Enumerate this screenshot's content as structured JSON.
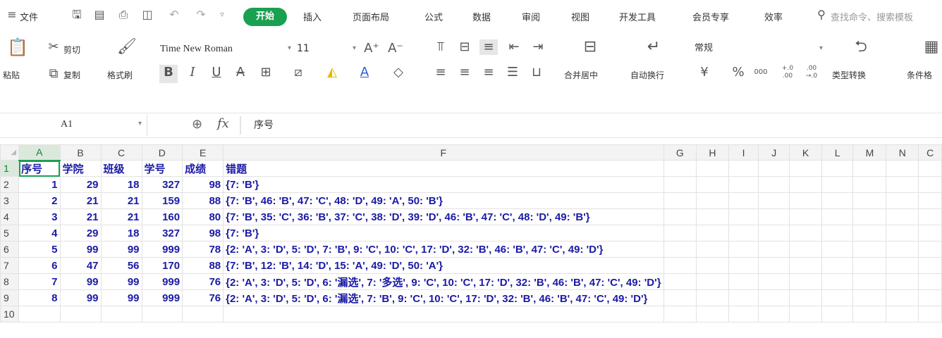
{
  "menubar": {
    "file": "文件",
    "tabs": [
      "开始",
      "插入",
      "页面布局",
      "公式",
      "数据",
      "审阅",
      "视图",
      "开发工具",
      "会员专享",
      "效率"
    ],
    "active_tab": "开始",
    "search_placeholder": "查找命令、搜索模板"
  },
  "ribbon": {
    "paste": "粘贴",
    "cut": "剪切",
    "copy": "复制",
    "format_painter": "格式刷",
    "font_name": "Time New Roman",
    "font_size": "11",
    "bold": "B",
    "italic": "I",
    "underline": "U",
    "strikethrough": "A",
    "font_color": "A",
    "merge_center": "合并居中",
    "auto_wrap": "自动换行",
    "number_format": "常规",
    "currency": "¥",
    "percent": "%",
    "thousands": "000",
    "inc_decimal": "+.0 .00",
    "dec_decimal": ".00 →.0",
    "type_convert": "类型转换",
    "conditional_format": "条件格"
  },
  "formula": {
    "cell_ref": "A1",
    "fx": "fx",
    "content": "序号"
  },
  "sheet": {
    "columns": [
      "A",
      "B",
      "C",
      "D",
      "E",
      "F",
      "G",
      "H",
      "I",
      "J",
      "K",
      "L",
      "M",
      "N",
      "C"
    ],
    "row_numbers": [
      "1",
      "2",
      "3",
      "4",
      "5",
      "6",
      "7",
      "8",
      "9",
      "10"
    ],
    "headers": [
      "序号",
      "学院",
      "班级",
      "学号",
      "成绩",
      "错题"
    ],
    "rows": [
      [
        "1",
        "29",
        "18",
        "327",
        "98",
        "{7: 'B'}"
      ],
      [
        "2",
        "21",
        "21",
        "159",
        "88",
        "{7: 'B', 46: 'B', 47: 'C', 48: 'D', 49: 'A', 50: 'B'}"
      ],
      [
        "3",
        "21",
        "21",
        "160",
        "80",
        "{7: 'B', 35: 'C', 36: 'B', 37: 'C', 38: 'D', 39: 'D', 46: 'B', 47: 'C', 48: 'D', 49: 'B'}"
      ],
      [
        "4",
        "29",
        "18",
        "327",
        "98",
        "{7: 'B'}"
      ],
      [
        "5",
        "99",
        "99",
        "999",
        "78",
        "{2: 'A', 3: 'D', 5: 'D', 7: 'B', 9: 'C', 10: 'C', 17: 'D', 32: 'B', 46: 'B', 47: 'C', 49: 'D'}"
      ],
      [
        "6",
        "47",
        "56",
        "170",
        "88",
        "{7: 'B', 12: 'B', 14: 'D', 15: 'A', 49: 'D', 50: 'A'}"
      ],
      [
        "7",
        "99",
        "99",
        "999",
        "76",
        "{2: 'A', 3: 'D', 5: 'D', 6: '漏选', 7: '多选', 9: 'C', 10: 'C', 17: 'D', 32: 'B', 46: 'B', 47: 'C', 49: 'D'}"
      ],
      [
        "8",
        "99",
        "99",
        "999",
        "76",
        "{2: 'A', 3: 'D', 5: 'D', 6: '漏选', 7: 'B', 9: 'C', 10: 'C', 17: 'D', 32: 'B', 46: 'B', 47: 'C', 49: 'D'}"
      ]
    ]
  }
}
